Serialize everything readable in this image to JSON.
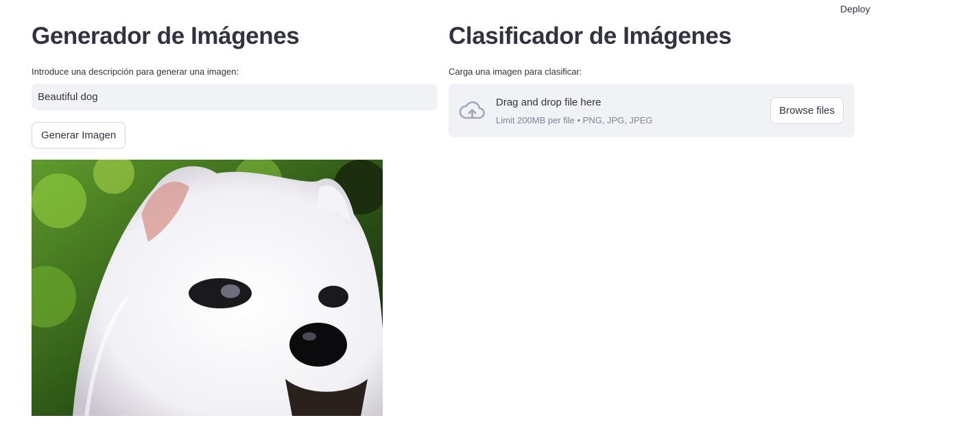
{
  "header": {
    "deploy_label": "Deploy"
  },
  "generator": {
    "title": "Generador de Imágenes",
    "prompt_label": "Introduce una descripción para generar una imagen:",
    "prompt_value": "Beautiful dog",
    "generate_label": "Generar Imagen"
  },
  "classifier": {
    "title": "Clasificador de Imágenes",
    "upload_label": "Carga una imagen para clasificar:",
    "drop_title": "Drag and drop file here",
    "drop_subtitle": "Limit 200MB per file • PNG, JPG, JPEG",
    "browse_label": "Browse files"
  },
  "icons": {
    "upload": "cloud-upload-icon"
  },
  "colors": {
    "input_bg": "#f0f2f6",
    "text": "#31333f",
    "muted": "#808495",
    "icon": "#a3a8b8"
  }
}
